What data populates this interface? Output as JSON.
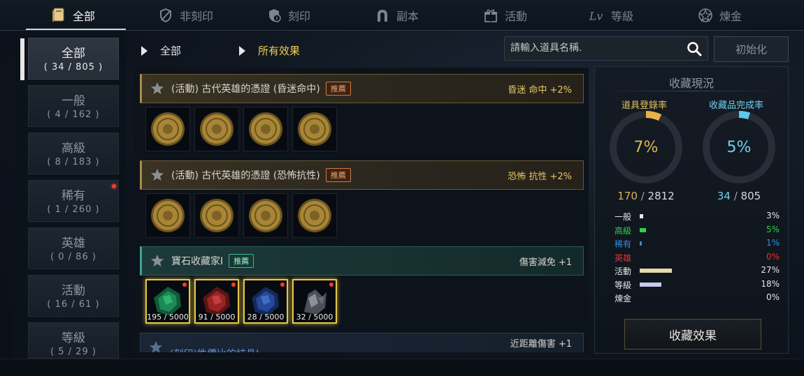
{
  "tabs": [
    {
      "label": "全部",
      "icon": "book-icon",
      "active": true
    },
    {
      "label": "非刻印",
      "icon": "shield-off-icon",
      "active": false
    },
    {
      "label": "刻印",
      "icon": "shield-info-icon",
      "active": false
    },
    {
      "label": "副本",
      "icon": "horseshoe-icon",
      "active": false
    },
    {
      "label": "活動",
      "icon": "gift-icon",
      "active": false
    },
    {
      "label": "等級",
      "icon": "level-icon",
      "active": false
    },
    {
      "label": "煉金",
      "icon": "alchemy-icon",
      "active": false
    }
  ],
  "sidebar": {
    "items": [
      {
        "label": "全部",
        "count": "( 34 / 805 )",
        "active": true,
        "dot": false
      },
      {
        "label": "一般",
        "count": "( 4 / 162 )",
        "active": false,
        "dot": false
      },
      {
        "label": "高級",
        "count": "( 8 / 183 )",
        "active": false,
        "dot": false
      },
      {
        "label": "稀有",
        "count": "( 1 / 260 )",
        "active": false,
        "dot": true
      },
      {
        "label": "英雄",
        "count": "( 0 / 86 )",
        "active": false,
        "dot": false
      },
      {
        "label": "活動",
        "count": "( 16 / 61 )",
        "active": false,
        "dot": false
      },
      {
        "label": "等級",
        "count": "( 5 / 29 )",
        "active": false,
        "dot": false
      }
    ]
  },
  "filters": {
    "category": "全部",
    "effect": "所有效果",
    "effect_color": "#f2cf4e"
  },
  "search": {
    "placeholder": "請輸入道具名稱.",
    "icon": "search-icon"
  },
  "reset_label": "初始化",
  "sets": [
    {
      "name": "(活動) 古代英雄的憑證 (昏迷命中)",
      "badge": "推薦",
      "effect": "昏迷 命中 +2%",
      "style": "gold",
      "items": [
        {
          "type": "coin"
        },
        {
          "type": "coin"
        },
        {
          "type": "coin"
        },
        {
          "type": "coin"
        }
      ]
    },
    {
      "name": "(活動) 古代英雄的憑證 (恐怖抗性)",
      "badge": "推薦",
      "effect": "恐怖 抗性 +2%",
      "style": "gold",
      "items": [
        {
          "type": "coin"
        },
        {
          "type": "coin"
        },
        {
          "type": "coin"
        },
        {
          "type": "coin"
        }
      ]
    },
    {
      "name": "寶石收藏家I",
      "badge": "推薦",
      "effect": "傷害減免 +1",
      "style": "teal",
      "items": [
        {
          "type": "green-gem",
          "progress": "195 / 5000"
        },
        {
          "type": "red-gem",
          "progress": "91 / 5000"
        },
        {
          "type": "blue-gem",
          "progress": "28 / 5000"
        },
        {
          "type": "gray-ore",
          "progress": "32 / 5000"
        }
      ]
    },
    {
      "name": "(刻印)性價比的結晶I",
      "effect": "近距離傷害 +1",
      "style": "blue"
    }
  ],
  "status": {
    "title": "收藏現況",
    "registration": {
      "label": "道具登錄率",
      "percent": "7%",
      "owned": "170",
      "total": "2812",
      "fraction": 0.07,
      "color": "#e8b24a"
    },
    "completion": {
      "label": "收藏品完成率",
      "percent": "5%",
      "owned": "34",
      "total": "805",
      "fraction": 0.05,
      "color": "#5ec8ea"
    },
    "grades": [
      {
        "name": "一般",
        "percent": "3%",
        "fraction": 0.03,
        "color": "#e6e6e6"
      },
      {
        "name": "高級",
        "percent": "5%",
        "fraction": 0.05,
        "color": "#31d04a"
      },
      {
        "name": "稀有",
        "percent": "1%",
        "fraction": 0.01,
        "color": "#2e8fe6"
      },
      {
        "name": "英雄",
        "percent": "0%",
        "fraction": 0.0,
        "color": "#e8322e"
      },
      {
        "name": "活動",
        "percent": "27%",
        "fraction": 0.27,
        "color": "#e2dba8"
      },
      {
        "name": "等級",
        "percent": "18%",
        "fraction": 0.18,
        "color": "#c7c9ef"
      },
      {
        "name": "煉金",
        "percent": "0%",
        "fraction": 0.0,
        "color": "#d9d9d9"
      }
    ],
    "effect_button": "收藏效果"
  }
}
